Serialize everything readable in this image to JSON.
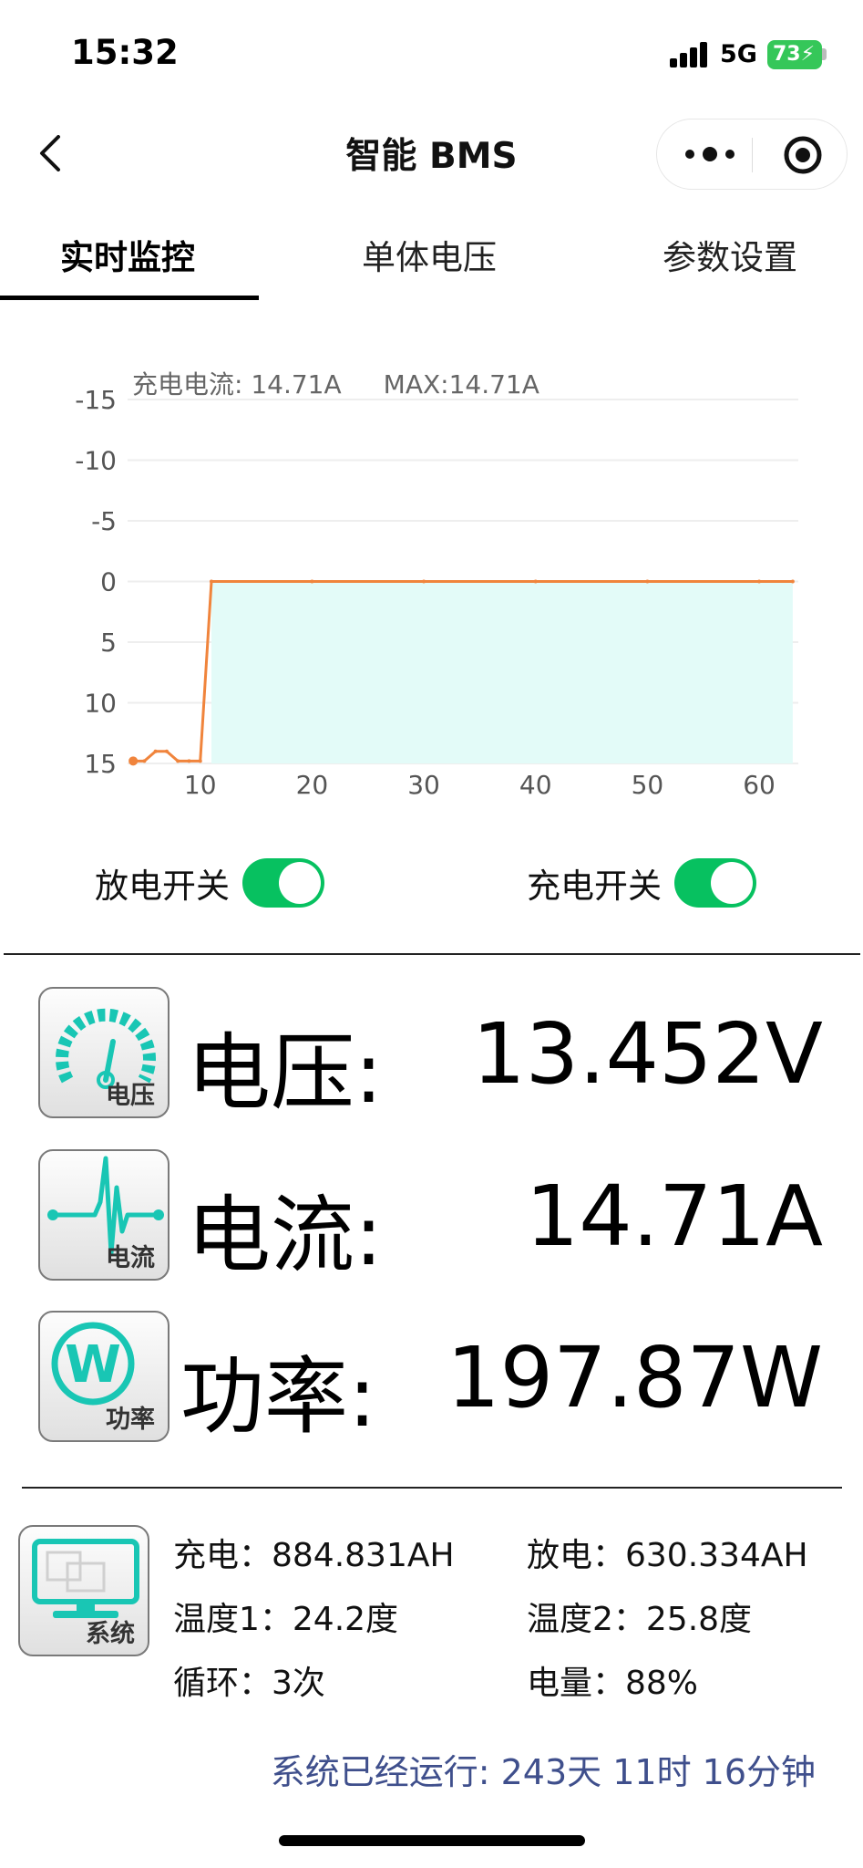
{
  "status_bar": {
    "time": "15:32",
    "network": "5G",
    "battery": "73"
  },
  "nav": {
    "title": "智能 BMS"
  },
  "tabs": [
    {
      "label": "实时监控",
      "active": true
    },
    {
      "label": "单体电压",
      "active": false
    },
    {
      "label": "参数设置",
      "active": false
    }
  ],
  "chart_header": {
    "current": "充电电流: 14.71A",
    "max": "MAX:14.71A"
  },
  "chart_data": {
    "type": "area",
    "title": "",
    "xlabel": "",
    "ylabel": "",
    "ylim": [
      -15,
      15
    ],
    "y_inverted": true,
    "y_ticks": [
      -15,
      -10,
      -5,
      0,
      5,
      10,
      15
    ],
    "x_ticks": [
      10,
      20,
      30,
      40,
      50,
      60
    ],
    "xlim": [
      3.5,
      63.5
    ],
    "series": [
      {
        "color": "#f0843c",
        "fill": "#e3fbf8",
        "points": [
          [
            4,
            14.8
          ],
          [
            5,
            14.8
          ],
          [
            6,
            14.0
          ],
          [
            7,
            14.0
          ],
          [
            8,
            14.8
          ],
          [
            9,
            14.8
          ],
          [
            10,
            14.8
          ],
          [
            11,
            0
          ],
          [
            20,
            0
          ],
          [
            30,
            0
          ],
          [
            40,
            0
          ],
          [
            50,
            0
          ],
          [
            60,
            0
          ],
          [
            63,
            0
          ]
        ]
      }
    ]
  },
  "switches": {
    "discharge": {
      "label": "放电开关",
      "on": true
    },
    "charge": {
      "label": "充电开关",
      "on": true
    }
  },
  "metrics": [
    {
      "icon": "voltage-gauge-icon",
      "icon_caption": "电压",
      "label": "电压:",
      "value": "13.452V"
    },
    {
      "icon": "current-wave-icon",
      "icon_caption": "电流",
      "label": "电流:",
      "value": "14.71A"
    },
    {
      "icon": "power-w-icon",
      "icon_caption": "功率",
      "label": "功率:",
      "value": "197.87W"
    }
  ],
  "system": {
    "icon": "system-monitor-icon",
    "icon_caption": "系统",
    "charge": "充电：884.831AH",
    "discharge": "放电：630.334AH",
    "temp1": "温度1：24.2度",
    "temp2": "温度2：25.8度",
    "cycles": "循环：3次",
    "soc": "电量：88%",
    "runtime": "系统已经运行: 243天 11时 16分钟"
  },
  "colors": {
    "accent_green": "#07c160",
    "teal_icon": "#19c6b4",
    "series_orange": "#f0843c",
    "runtime_blue": "#3f4f8c"
  }
}
